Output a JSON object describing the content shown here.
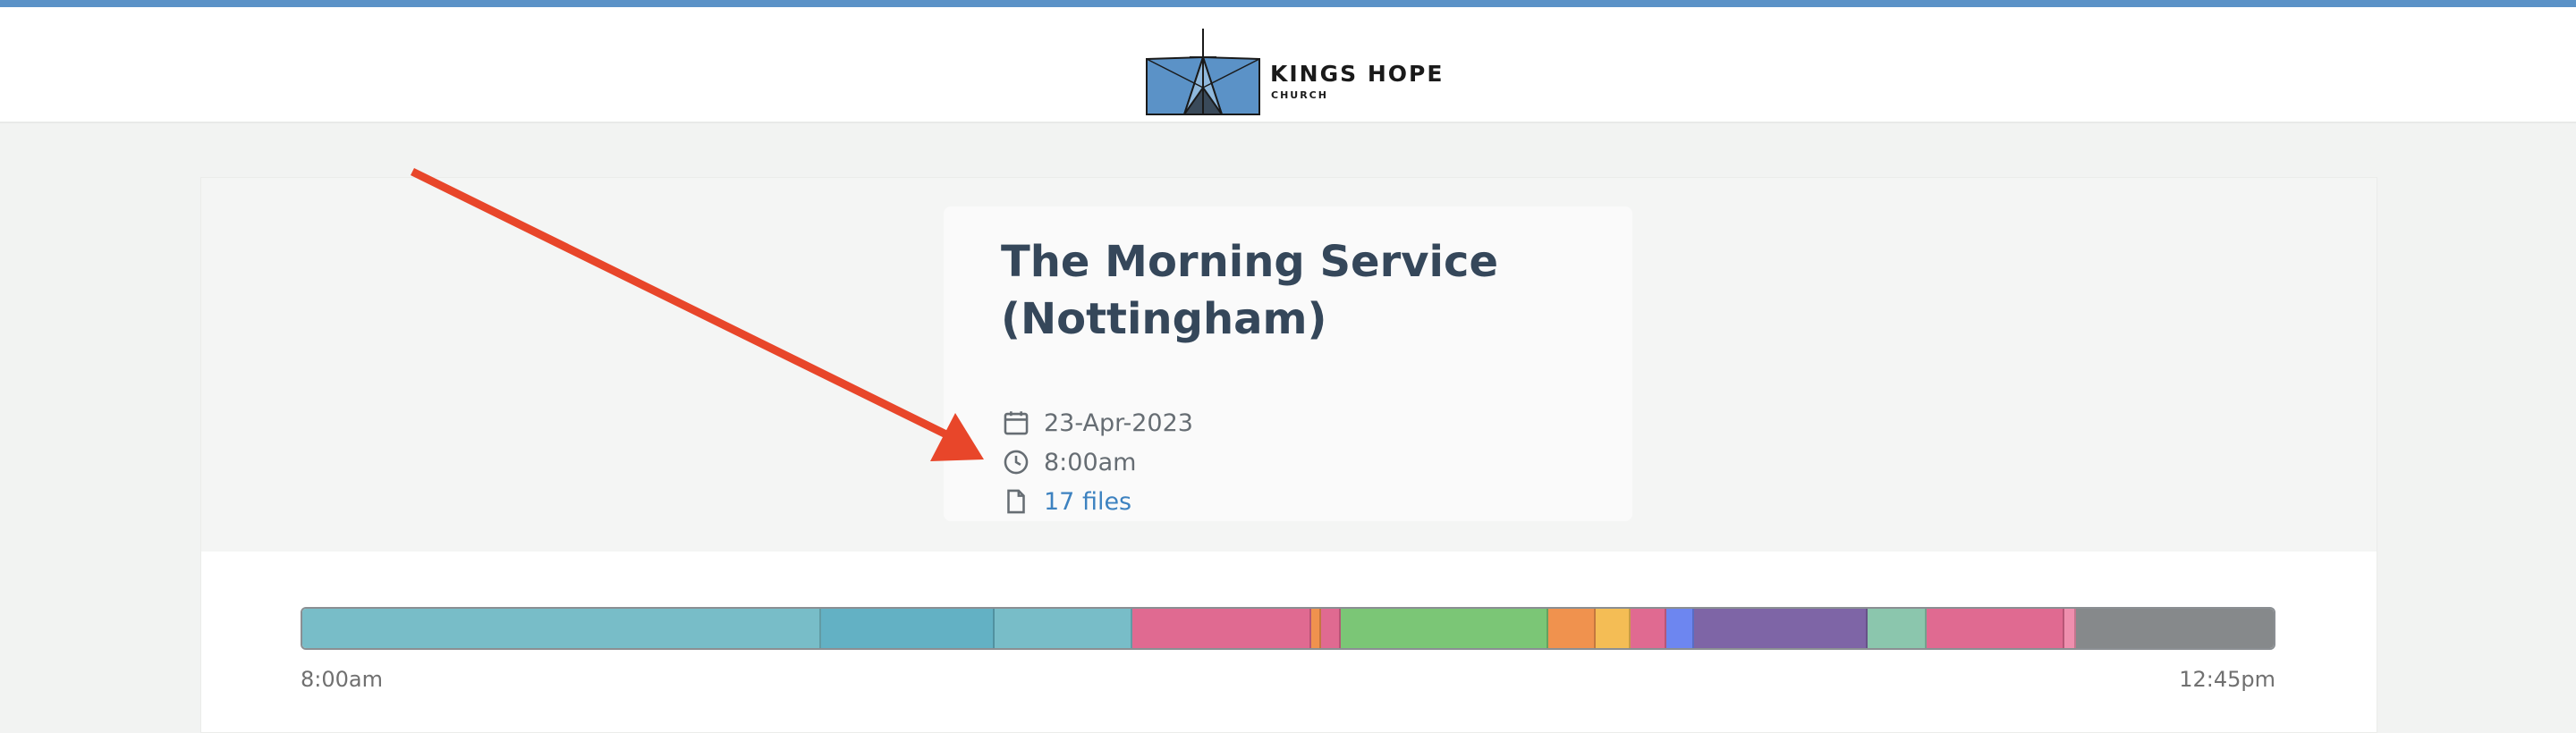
{
  "brand": {
    "name": "KINGS HOPE",
    "subtitle": "CHURCH"
  },
  "service": {
    "title": "The Morning Service (Nottingham)",
    "date": "23-Apr-2023",
    "time": "8:00am",
    "files": "17 files"
  },
  "icons": {
    "date": "calendar-icon",
    "time": "clock-icon",
    "files": "file-icon"
  },
  "timeline": {
    "start_label": "8:00am",
    "end_label": "12:45pm",
    "segments": [
      {
        "share": 26.3,
        "color": "#78bdc8"
      },
      {
        "share": 8.8,
        "color": "#63b1c4"
      },
      {
        "share": 7.0,
        "color": "#78bdc8"
      },
      {
        "share": 9.1,
        "color": "#e06a91"
      },
      {
        "share": 0.5,
        "color": "#f0924e"
      },
      {
        "share": 1.0,
        "color": "#e06a91"
      },
      {
        "share": 10.5,
        "color": "#7bc676"
      },
      {
        "share": 2.4,
        "color": "#f0924e"
      },
      {
        "share": 1.8,
        "color": "#f4bd55"
      },
      {
        "share": 1.8,
        "color": "#e06a91"
      },
      {
        "share": 1.4,
        "color": "#6d86f0"
      },
      {
        "share": 8.8,
        "color": "#7e65a6"
      },
      {
        "share": 3.0,
        "color": "#8bc6ad"
      },
      {
        "share": 7.0,
        "color": "#e06a91"
      },
      {
        "share": 0.6,
        "color": "#ef8fae"
      },
      {
        "share": 10.0,
        "color": "#86898b"
      }
    ]
  },
  "colors": {
    "accent": "#5b92c7",
    "annotation_arrow": "#e8462a",
    "link": "#3d82c0"
  }
}
